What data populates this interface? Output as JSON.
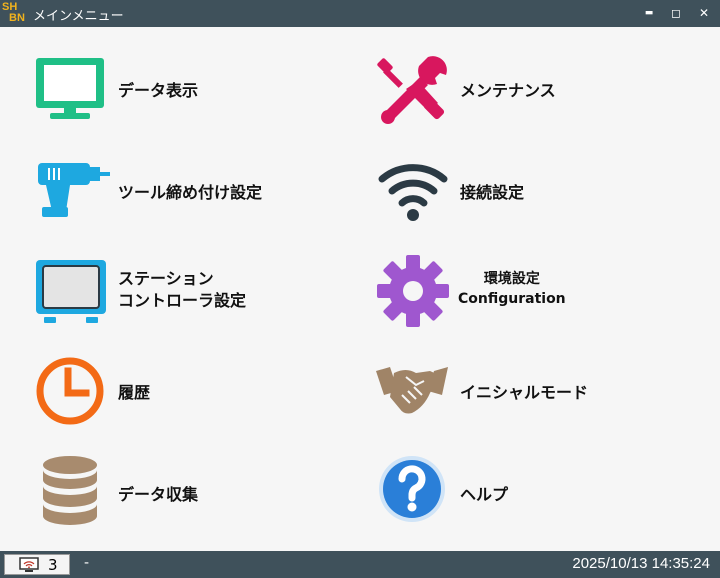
{
  "window": {
    "logo_top": "SH",
    "logo_bottom": "BN",
    "title": "メインメニュー",
    "minimize_glyph": "▬",
    "maximize_glyph": "◻",
    "close_glyph": "✕"
  },
  "menu": {
    "data_display": {
      "label": "データ表示",
      "icon": "monitor-icon",
      "color": "#1fbf86"
    },
    "maintenance": {
      "label": "メンテナンス",
      "icon": "wrench-screwdriver-icon",
      "color": "#d8175e"
    },
    "tool_tightening": {
      "label": "ツール締め付け設定",
      "icon": "drill-icon",
      "color": "#1ea8e0"
    },
    "connection": {
      "label": "接続設定",
      "icon": "wifi-icon",
      "color": "#2b3a44"
    },
    "station_controller": {
      "label_line1": "ステーション",
      "label_line2": "コントローラ設定",
      "icon": "tablet-icon",
      "color": "#1ea8e0"
    },
    "environment": {
      "label_line1": "環境設定",
      "label_line2": "Configuration",
      "icon": "gear-icon",
      "color": "#9f57cf"
    },
    "history": {
      "label": "履歴",
      "icon": "clock-icon",
      "color": "#f36a16"
    },
    "initial_mode": {
      "label": "イニシャルモード",
      "icon": "handshake-icon",
      "color": "#a08467"
    },
    "data_collection": {
      "label": "データ収集",
      "icon": "database-icon",
      "color": "#a88b6e"
    },
    "help": {
      "label": "ヘルプ",
      "icon": "help-icon",
      "color": "#2a7fd8"
    }
  },
  "statusbar": {
    "connection_icon": "wifi-monitor-icon",
    "count": "3",
    "separator": "-",
    "datetime": "2025/10/13 14:35:24"
  }
}
